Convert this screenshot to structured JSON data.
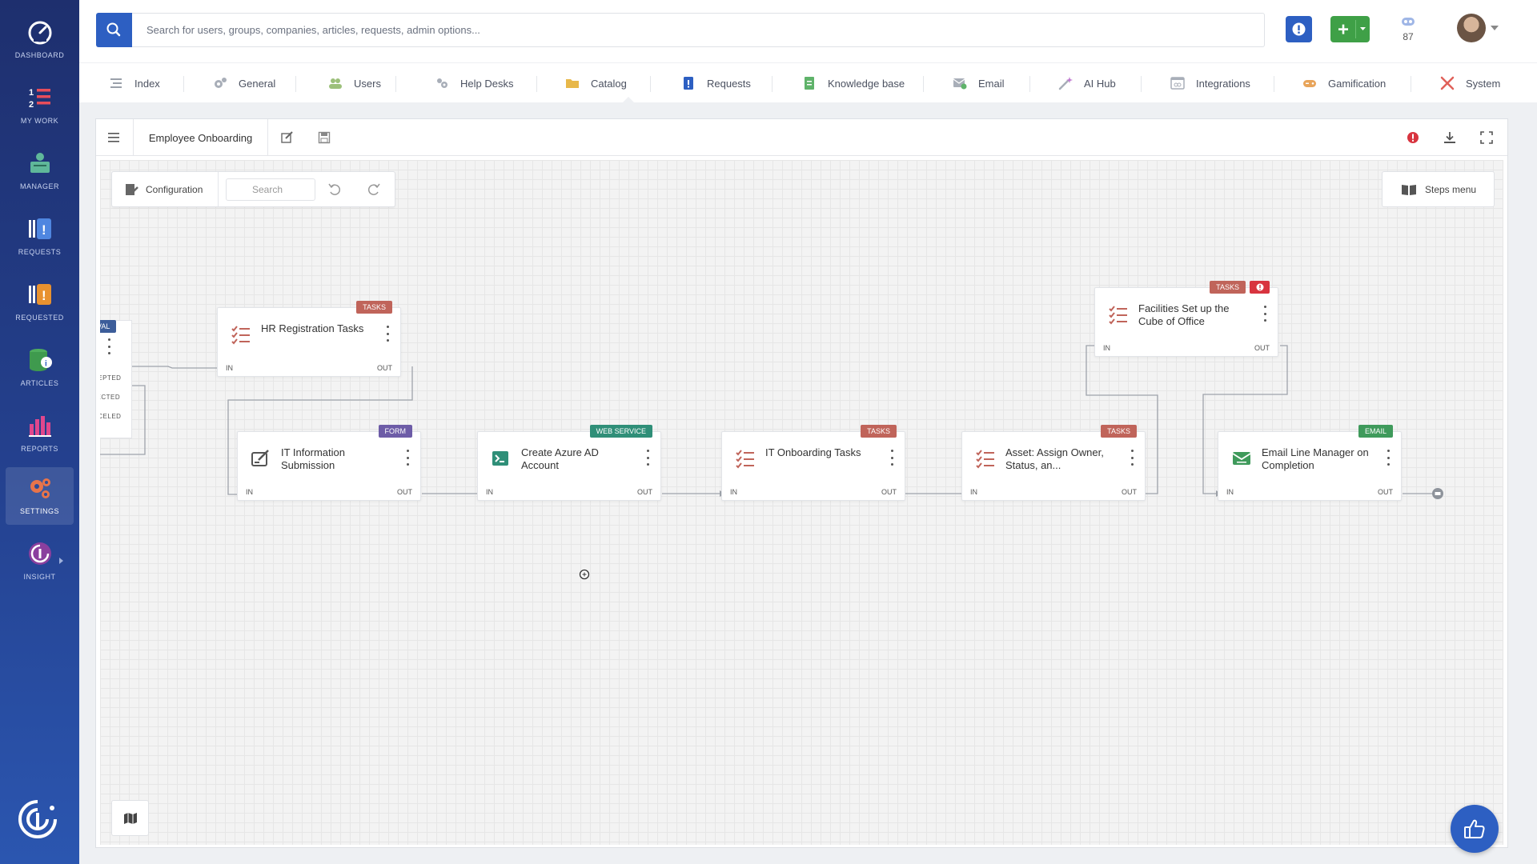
{
  "sidebar": {
    "items": [
      {
        "label": "DASHBOARD",
        "icon": "dashboard-gauge-icon"
      },
      {
        "label": "MY WORK",
        "icon": "my-work-list-icon"
      },
      {
        "label": "MANAGER",
        "icon": "manager-icon"
      },
      {
        "label": "REQUESTS",
        "icon": "requests-icon"
      },
      {
        "label": "REQUESTED",
        "icon": "requested-icon"
      },
      {
        "label": "ARTICLES",
        "icon": "articles-icon"
      },
      {
        "label": "REPORTS",
        "icon": "reports-bar-icon"
      },
      {
        "label": "SETTINGS",
        "icon": "settings-gears-icon",
        "active": true
      },
      {
        "label": "INSIGHT",
        "icon": "insight-icon"
      }
    ]
  },
  "topbar": {
    "search_placeholder": "Search for users, groups, companies, articles, requests, admin options...",
    "notification_count": "87"
  },
  "tabs": [
    {
      "label": "Index",
      "icon": "index-icon"
    },
    {
      "label": "General",
      "icon": "general-gears-icon"
    },
    {
      "label": "Users",
      "icon": "users-icon"
    },
    {
      "label": "Help Desks",
      "icon": "help-desks-icon"
    },
    {
      "label": "Catalog",
      "icon": "catalog-folder-icon"
    },
    {
      "label": "Requests",
      "icon": "requests-doc-icon",
      "active": true
    },
    {
      "label": "Knowledge base",
      "icon": "knowledge-base-icon"
    },
    {
      "label": "Email",
      "icon": "email-icon"
    },
    {
      "label": "AI Hub",
      "icon": "ai-hub-wand-icon"
    },
    {
      "label": "Integrations",
      "icon": "integrations-icon"
    },
    {
      "label": "Gamification",
      "icon": "gamification-icon"
    },
    {
      "label": "System",
      "icon": "system-tools-icon"
    }
  ],
  "editor": {
    "title": "Employee Onboarding",
    "toolbar": {
      "config_label": "Configuration",
      "search_placeholder": "Search",
      "steps_menu_label": "Steps menu"
    }
  },
  "nodes": [
    {
      "title": "HR Registration Tasks",
      "badge": "TASKS",
      "in": "IN",
      "out": "OUT"
    },
    {
      "title": "IT Information Submission",
      "badge": "FORM",
      "in": "IN",
      "out": "OUT"
    },
    {
      "title": "Create Azure AD Account",
      "badge": "WEB SERVICE",
      "in": "IN",
      "out": "OUT"
    },
    {
      "title": "IT Onboarding Tasks",
      "badge": "TASKS",
      "in": "IN",
      "out": "OUT"
    },
    {
      "title": "Asset: Assign Owner, Status, an...",
      "badge": "TASKS",
      "in": "IN",
      "out": "OUT"
    },
    {
      "title": "Facilities Set up the Cube of Office",
      "badge": "TASKS",
      "in": "IN",
      "out": "OUT"
    },
    {
      "title": "Email Line Manager on Completion",
      "badge": "EMAIL",
      "in": "IN",
      "out": "OUT"
    }
  ],
  "partial_node": {
    "badge": "OVAL",
    "ports": [
      "CEPTED",
      "JECTED",
      "NCELED"
    ]
  },
  "colors": {
    "primary": "#2d5fc2",
    "add_green": "#3fa047",
    "tasks_badge": "#c0645a",
    "form_badge": "#6d5ca7",
    "web_service_badge": "#2f8f78",
    "email_badge": "#3f9a5b",
    "approval_badge": "#3c5d9a",
    "error_red": "#d8343f"
  }
}
